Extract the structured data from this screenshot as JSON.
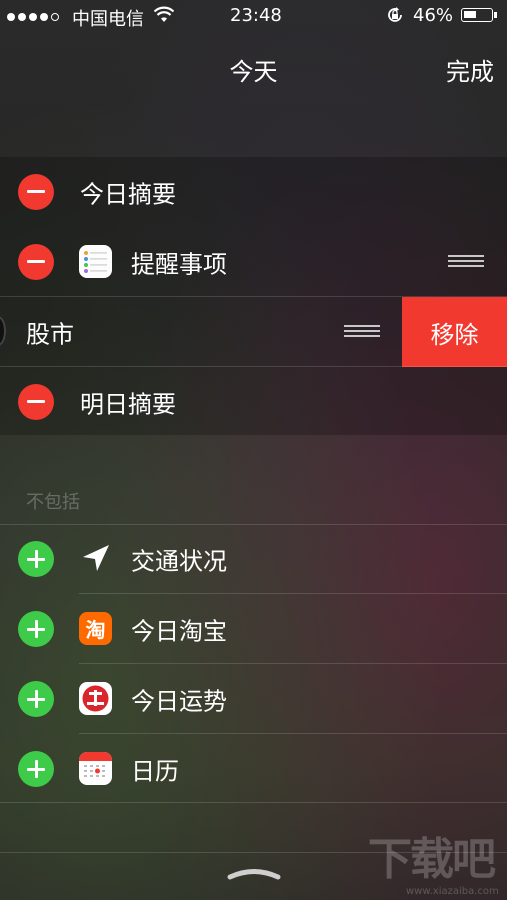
{
  "status_bar": {
    "carrier": "中国电信",
    "time": "23:48",
    "battery_percent": "46%",
    "battery_level": 0.46,
    "signal_bars_filled": 4,
    "signal_bars_total": 5
  },
  "header": {
    "title": "今天",
    "done_label": "完成"
  },
  "included": [
    {
      "label": "今日摘要",
      "icon": null
    },
    {
      "label": "提醒事项",
      "icon": "reminders-app-icon"
    },
    {
      "label": "股市",
      "icon": null,
      "swiped": true
    },
    {
      "label": "明日摘要",
      "icon": null
    }
  ],
  "remove_label": "移除",
  "excluded_header": "不包括",
  "excluded": [
    {
      "label": "交通状况",
      "icon": "location-arrow-icon"
    },
    {
      "label": "今日淘宝",
      "icon": "taobao-app-icon",
      "icon_text": "淘"
    },
    {
      "label": "今日运势",
      "icon": "fortune-app-icon"
    },
    {
      "label": "日历",
      "icon": "calendar-app-icon"
    }
  ],
  "watermark": {
    "logo": "下载吧",
    "url": "www.xiazaiba.com"
  },
  "colors": {
    "remove_red": "#f2392f",
    "add_green": "#3fcb4a",
    "taobao_orange": "#ff6a00"
  }
}
